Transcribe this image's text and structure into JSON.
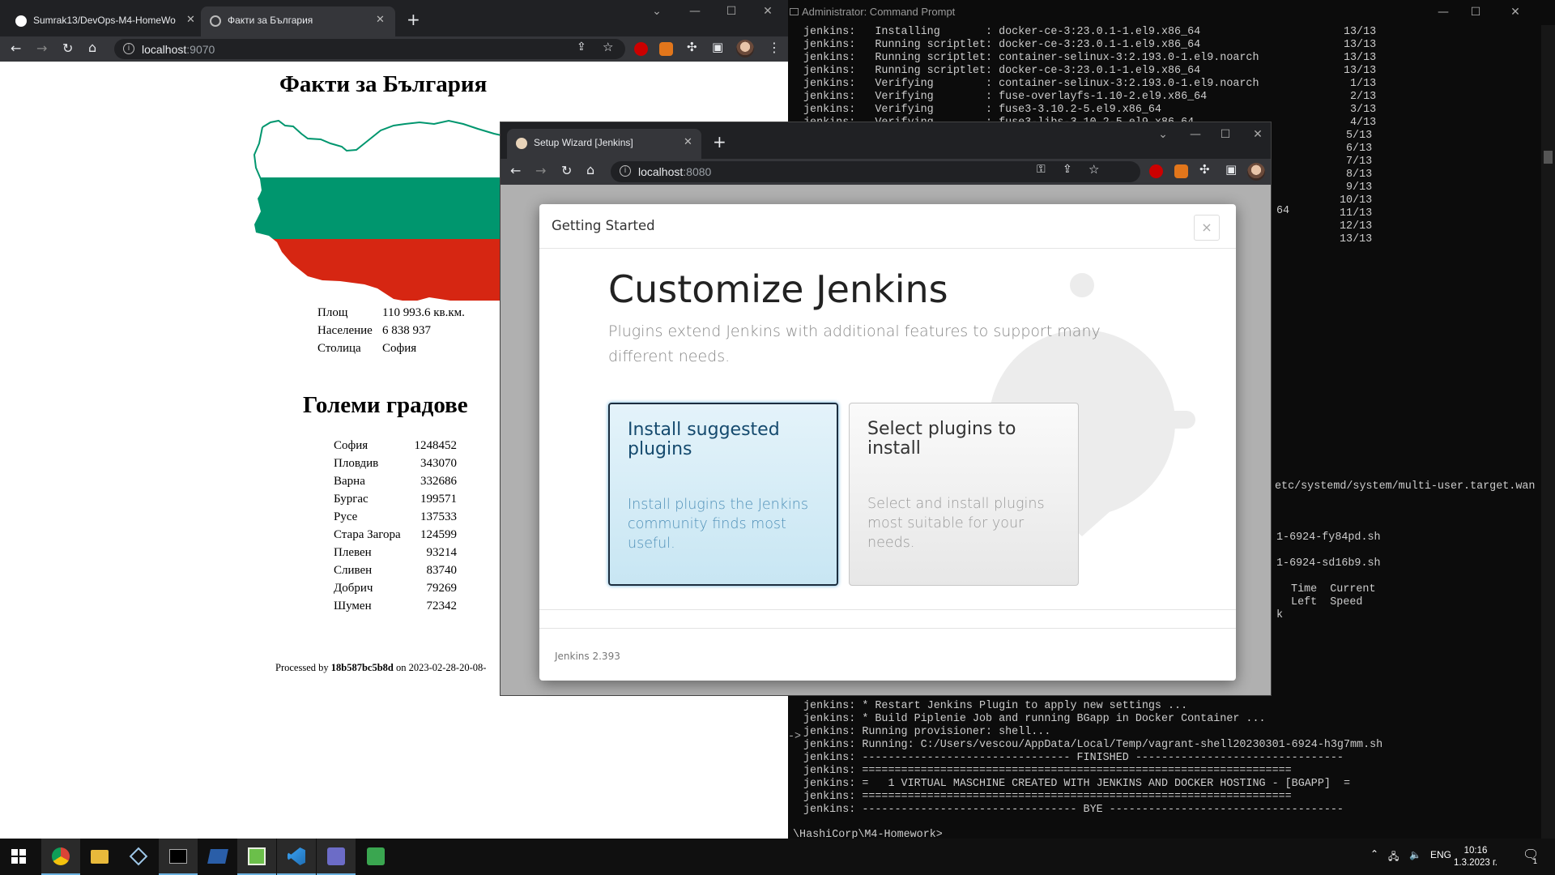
{
  "terminal": {
    "title": "Administrator: Command Prompt",
    "lines_top": [
      "jenkins:   Installing       : docker-ce-3:23.0.1-1.el9.x86_64                      13/13",
      "jenkins:   Running scriptlet: docker-ce-3:23.0.1-1.el9.x86_64                      13/13",
      "jenkins:   Running scriptlet: container-selinux-3:2.193.0-1.el9.noarch             13/13",
      "jenkins:   Running scriptlet: docker-ce-3:23.0.1-1.el9.x86_64                      13/13",
      "jenkins:   Verifying        : container-selinux-3:2.193.0-1.el9.noarch              1/13",
      "jenkins:   Verifying        : fuse-overlayfs-1.10-2.el9.x86_64                      2/13",
      "jenkins:   Verifying        : fuse3-3.10.2-5.el9.x86_64                             3/13",
      "jenkins:   Verifying        : fuse3-libs-3.10.2-5.el9.x86_64                        4/13"
    ],
    "right_fragments": [
      "5/13",
      "6/13",
      "7/13",
      "8/13",
      "9/13",
      "10/13",
      "11/13",
      "12/13",
      "13/13"
    ],
    "fragment_64": "64",
    "fragment_systemd": "etc/systemd/system/multi-user.target.wan",
    "fragment_sh1": "1-6924-fy84pd.sh",
    "fragment_sh2": "1-6924-sd16b9.sh",
    "fragment_header1": " Time  Current",
    "fragment_header2": " Left  Speed",
    "fragment_k": "k",
    "lines_bottom": [
      "jenkins: * Restart Jenkins Plugin to apply new settings ...",
      "jenkins: * Build Piplenie Job and running BGapp in Docker Container ...",
      "jenkins: Running provisioner: shell...",
      "jenkins: Running: C:/Users/vescou/AppData/Local/Temp/vagrant-shell20230301-6924-h3g7mm.sh",
      "jenkins: -------------------------------- FINISHED --------------------------------",
      "jenkins: ==================================================================",
      "jenkins: =   1 VIRTUAL MASCHINE CREATED WITH JENKINS AND DOCKER HOSTING - [BGAPP]  =",
      "jenkins: ==================================================================",
      "jenkins: --------------------------------- BYE ------------------------------------"
    ],
    "prompt": "\\HashiCorp\\M4-Homework>",
    "arrow_mark": "->"
  },
  "browser1": {
    "tabs": [
      {
        "label": "Sumrak13/DevOps-M4-HomeWo"
      },
      {
        "label": "Факти за България"
      }
    ],
    "url_host": "localhost",
    "url_port": ":9070",
    "page": {
      "title": "Факти за България",
      "facts": [
        {
          "key": "Площ",
          "value": "110 993.6 кв.км."
        },
        {
          "key": "Население",
          "value": "6 838 937"
        },
        {
          "key": "Столица",
          "value": "София"
        }
      ],
      "cities_title": "Големи градове",
      "cities": [
        {
          "name": "София",
          "pop": "1248452"
        },
        {
          "name": "Пловдив",
          "pop": "343070"
        },
        {
          "name": "Варна",
          "pop": "332686"
        },
        {
          "name": "Бургас",
          "pop": "199571"
        },
        {
          "name": "Русе",
          "pop": "137533"
        },
        {
          "name": "Стара Загора",
          "pop": "124599"
        },
        {
          "name": "Плевен",
          "pop": "93214"
        },
        {
          "name": "Сливен",
          "pop": "83740"
        },
        {
          "name": "Добрич",
          "pop": "79269"
        },
        {
          "name": "Шумен",
          "pop": "72342"
        }
      ],
      "processed_prefix": "Processed by",
      "processed_host": "18b587bc5b8d",
      "processed_on": "on 2023-02-28-20-08-"
    }
  },
  "browser2": {
    "tab_label": "Setup Wizard [Jenkins]",
    "url_host": "localhost",
    "url_port": ":8080",
    "modal": {
      "header": "Getting Started",
      "close": "×",
      "heading": "Customize Jenkins",
      "lead": "Plugins extend Jenkins with additional features to support many different needs.",
      "option1_title": "Install suggested plugins",
      "option1_desc": "Install plugins the Jenkins community finds most useful.",
      "option2_title": "Select plugins to install",
      "option2_desc": "Select and install plugins most suitable for your needs.",
      "version": "Jenkins 2.393"
    }
  },
  "taskbar": {
    "language": "ENG",
    "time": "10:16",
    "date": "1.3.2023 г.",
    "notifications": "1"
  },
  "colors": {
    "flag_white": "#ffffff",
    "flag_green": "#00966e",
    "flag_red": "#d62612",
    "jenkins_blue": "#154a6e"
  }
}
